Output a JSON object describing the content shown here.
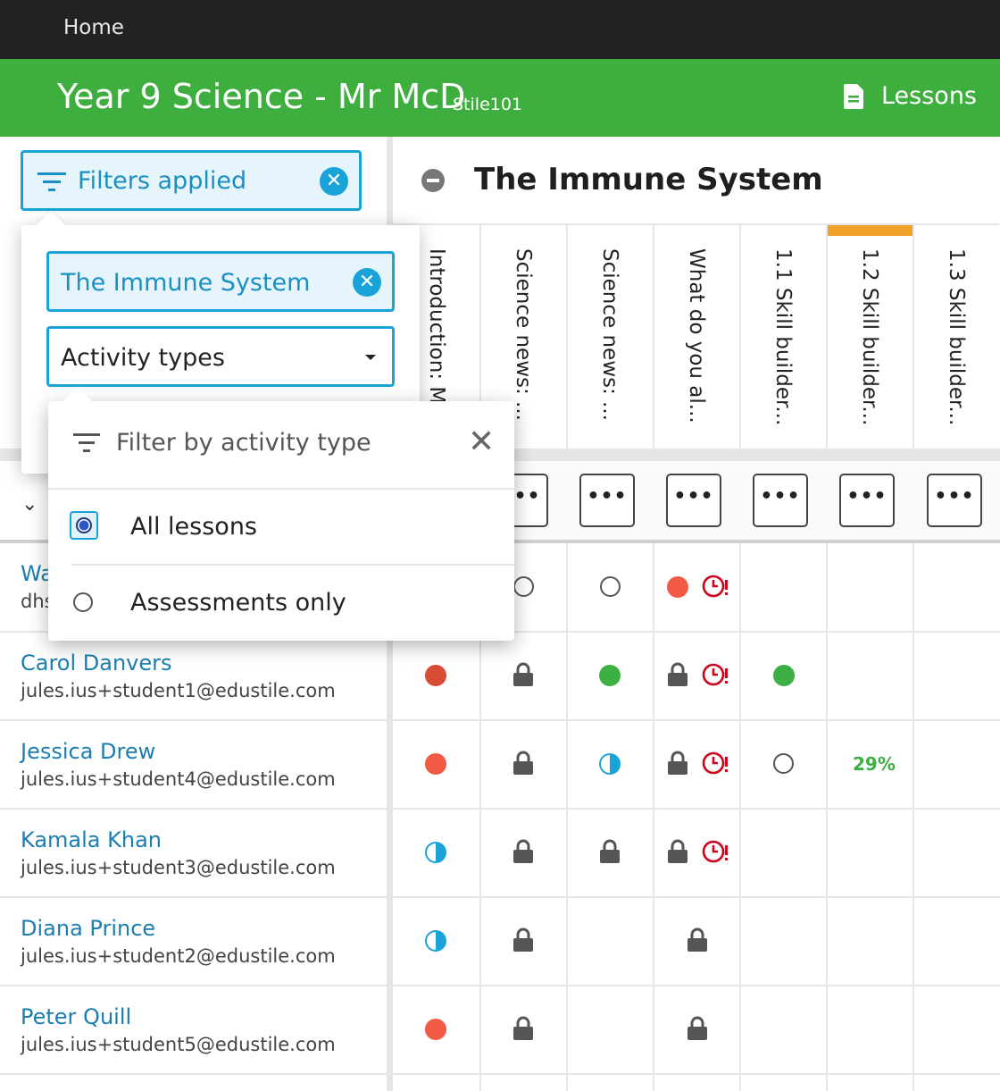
{
  "nav": {
    "home": "Home"
  },
  "header": {
    "title": "Year 9 Science - Mr McD",
    "code": "Stile101",
    "lessons": "Lessons"
  },
  "filters": {
    "button_label": "Filters applied",
    "unit_chip": "The Immune System",
    "activity_select": "Activity types"
  },
  "activity_popover": {
    "title": "Filter by activity type",
    "options": [
      "All lessons",
      "Assessments only"
    ],
    "selected": "All lessons"
  },
  "unit": {
    "title": "The Immune System"
  },
  "columns": [
    "Introduction: M",
    "Science news: ...",
    "Science news: ...",
    "What do you al...",
    "1.1 Skill builder...",
    "1.2 Skill builder...",
    "1.3 Skill builder..."
  ],
  "menu_button": "•••",
  "students": [
    {
      "name": "Wa",
      "email": "dhs"
    },
    {
      "name": "Carol Danvers",
      "email": "jules.ius+student1@edustile.com"
    },
    {
      "name": "Jessica Drew",
      "email": "jules.ius+student4@edustile.com"
    },
    {
      "name": "Kamala Khan",
      "email": "jules.ius+student3@edustile.com"
    },
    {
      "name": "Diana Prince",
      "email": "jules.ius+student2@edustile.com"
    },
    {
      "name": "Peter Quill",
      "email": "jules.ius+student5@edustile.com"
    }
  ],
  "progress": {
    "jessica_drew_skill_1_2": "29%"
  },
  "colors": {
    "accent": "#1aa3d9",
    "header_green": "#3eae3e",
    "flag_orange": "#f0a12a",
    "complete": "#3cb043",
    "overdue": "#f25a46"
  }
}
